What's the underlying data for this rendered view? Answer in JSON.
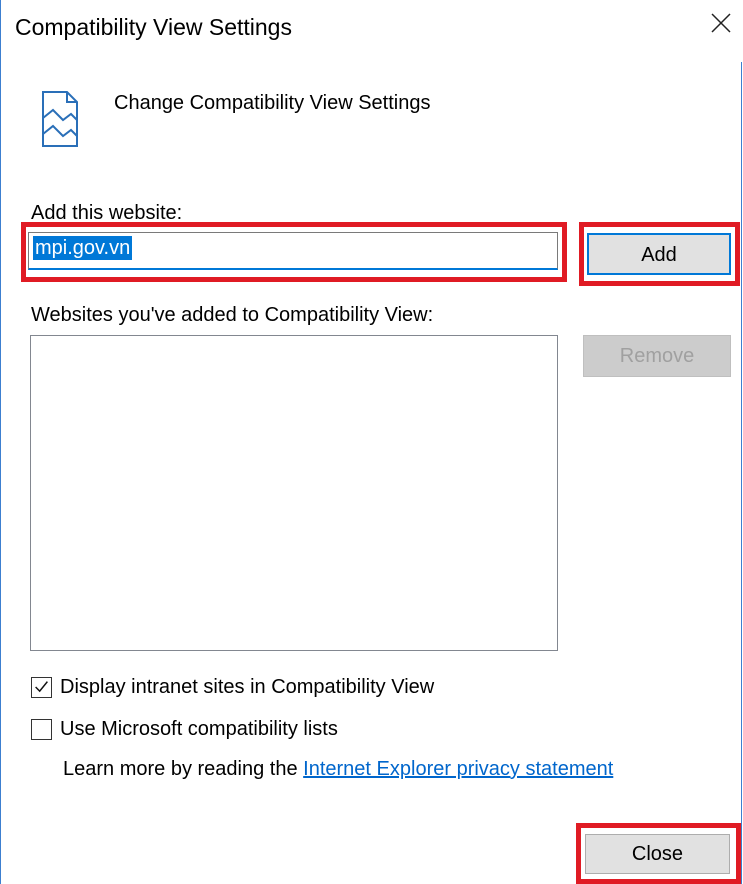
{
  "window": {
    "title": "Compatibility View Settings"
  },
  "header": {
    "text": "Change Compatibility View Settings"
  },
  "add_site": {
    "label": "Add this website:",
    "value": "mpi.gov.vn",
    "button": "Add"
  },
  "list": {
    "label": "Websites you've added to Compatibility View:",
    "items": [],
    "remove_button": "Remove"
  },
  "options": {
    "intranet": {
      "label": "Display intranet sites in Compatibility View",
      "checked": true
    },
    "ms_lists": {
      "label": "Use Microsoft compatibility lists",
      "checked": false
    }
  },
  "learn_more": {
    "prefix": "Learn more by reading the",
    "link": "Internet Explorer privacy statement"
  },
  "footer": {
    "close_button": "Close"
  },
  "colors": {
    "highlight": "#e01b24",
    "accent": "#0078d7",
    "link": "#0066cc"
  }
}
